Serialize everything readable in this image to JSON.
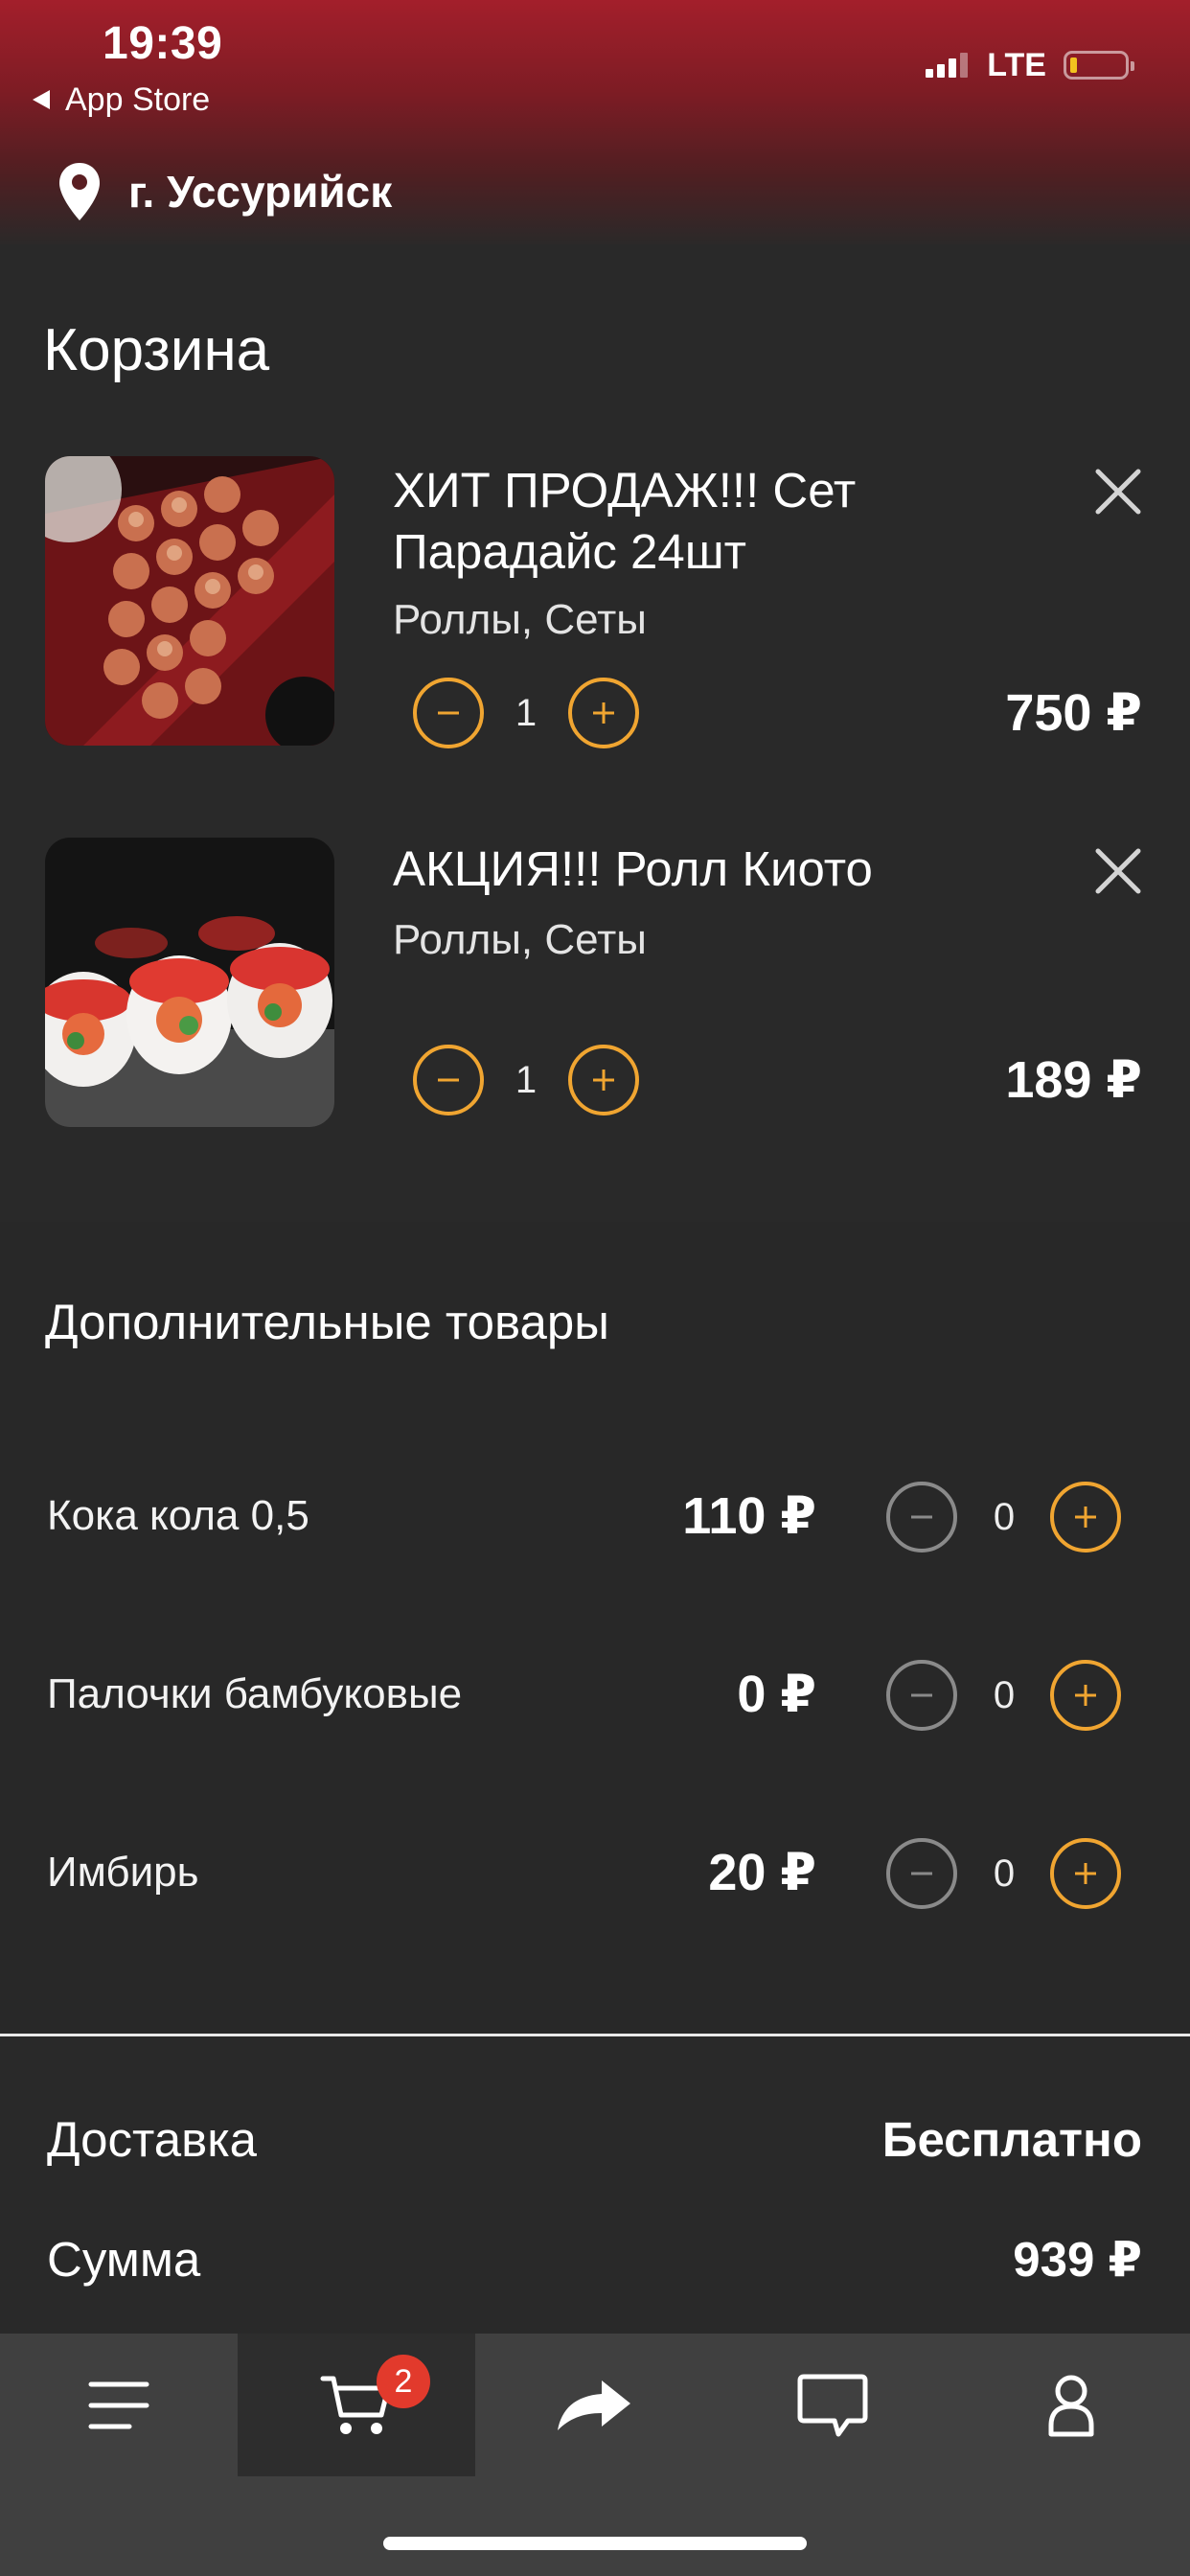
{
  "status_bar": {
    "time": "19:39",
    "back_label": "App Store",
    "network": "LTE",
    "battery_level": 0.15,
    "signal_bars": 3
  },
  "header": {
    "city": "г. Уссурийск"
  },
  "cart": {
    "title": "Корзина",
    "items": [
      {
        "name": "ХИТ ПРОДАЖ!!! Сет Парадайс 24шт",
        "category": "Роллы, Сеты",
        "quantity": "1",
        "price": "750 ₽"
      },
      {
        "name": "АКЦИЯ!!! Ролл Киото",
        "category": "Роллы, Сеты",
        "quantity": "1",
        "price": "189 ₽"
      }
    ]
  },
  "extras": {
    "title": "Дополнительные товары",
    "items": [
      {
        "name": "Кока кола 0,5",
        "price": "110 ₽",
        "quantity": "0"
      },
      {
        "name": "Палочки бамбуковые",
        "price": "0 ₽",
        "quantity": "0"
      },
      {
        "name": "Имбирь",
        "price": "20 ₽",
        "quantity": "0"
      }
    ]
  },
  "summary": {
    "delivery_label": "Доставка",
    "delivery_value": "Бесплатно",
    "total_label": "Сумма",
    "total_value": "939 ₽"
  },
  "tab_bar": {
    "active_tab": "cart",
    "cart_badge": "2",
    "icons": [
      "menu-icon",
      "cart-icon",
      "share-icon",
      "chat-icon",
      "profile-icon"
    ]
  },
  "colors": {
    "accent": "#f0a531",
    "badge": "#e23a2c",
    "header_top": "#a31f2b",
    "background": "#292929",
    "tab_bar": "#404040"
  }
}
